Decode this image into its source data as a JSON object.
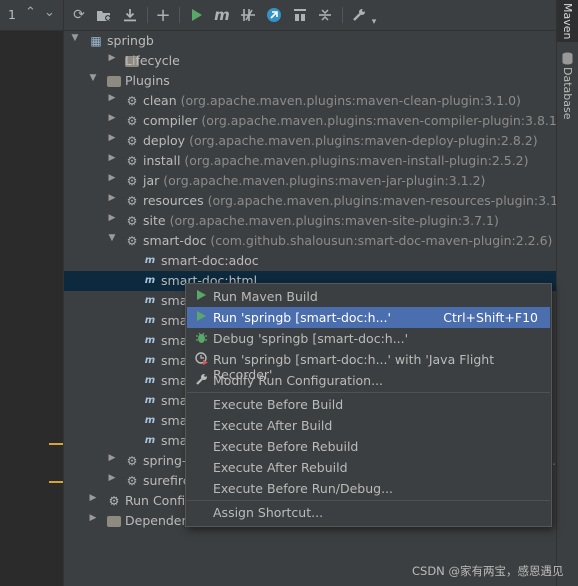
{
  "left_strip": {
    "line_indicator": "1"
  },
  "right_strip": {
    "maven_tab": "Maven",
    "database_tab": "Database"
  },
  "toolbar": {
    "items": [
      "reload-icon",
      "add-folder-icon",
      "download-icon",
      "plus-icon",
      "run-icon",
      "maven-m-icon",
      "toggle-offline-icon",
      "skip-tests-icon",
      "show-dependencies-icon",
      "collapse-all-icon",
      "wrench-icon"
    ]
  },
  "tree": {
    "project": "springb",
    "lifecycle": "Lifecycle",
    "plugins": "Plugins",
    "plugin_items": [
      {
        "name": "clean",
        "coord": "(org.apache.maven.plugins:maven-clean-plugin:3.1.0)"
      },
      {
        "name": "compiler",
        "coord": "(org.apache.maven.plugins:maven-compiler-plugin:3.8.1)"
      },
      {
        "name": "deploy",
        "coord": "(org.apache.maven.plugins:maven-deploy-plugin:2.8.2)"
      },
      {
        "name": "install",
        "coord": "(org.apache.maven.plugins:maven-install-plugin:2.5.2)"
      },
      {
        "name": "jar",
        "coord": "(org.apache.maven.plugins:maven-jar-plugin:3.1.2)"
      },
      {
        "name": "resources",
        "coord": "(org.apache.maven.plugins:maven-resources-plugin:3.1.0)"
      },
      {
        "name": "site",
        "coord": "(org.apache.maven.plugins:maven-site-plugin:3.7.1)"
      },
      {
        "name": "smart-doc",
        "coord": "(com.github.shalousun:smart-doc-maven-plugin:2.2.6)"
      }
    ],
    "goals": [
      "smart-doc:adoc",
      "smart-doc:html",
      "smar",
      "smar",
      "smar",
      "smar",
      "smar",
      "smar",
      "smar",
      "smar"
    ],
    "spring": "spring-l",
    "spring_tail": "5.",
    "surefire": "surefire",
    "run_configs": "Run Config",
    "dependencies": "Dependencies"
  },
  "context_menu": {
    "items": [
      {
        "label": "Run Maven Build",
        "icon": "run-icon"
      },
      {
        "label": "Run 'springb [smart-doc:h...'",
        "shortcut": "Ctrl+Shift+F10",
        "icon": "run-icon",
        "highlighted": true
      },
      {
        "label": "Debug 'springb [smart-doc:h...'",
        "icon": "debug-icon"
      },
      {
        "label": "Run 'springb [smart-doc:h...' with 'Java Flight Recorder'",
        "icon": "flight-recorder-icon"
      },
      {
        "label": "Modify Run Configuration...",
        "icon": "wrench-icon"
      },
      {
        "label": "Execute Before Build"
      },
      {
        "label": "Execute After Build"
      },
      {
        "label": "Execute Before Rebuild"
      },
      {
        "label": "Execute After Rebuild"
      },
      {
        "label": "Execute Before Run/Debug..."
      },
      {
        "label": "Assign Shortcut..."
      }
    ]
  },
  "watermark": "CSDN @家有两宝，感恩遇见"
}
